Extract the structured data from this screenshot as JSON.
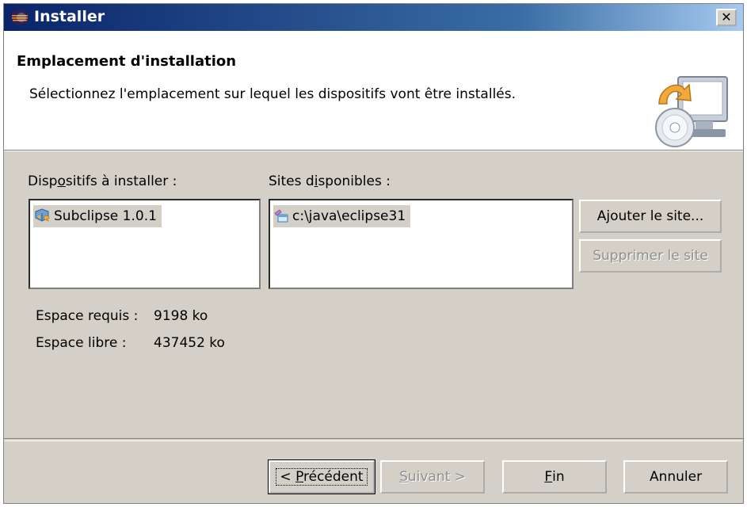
{
  "window": {
    "title": "Installer",
    "close_glyph": "✕"
  },
  "header": {
    "title": "Emplacement d'installation",
    "description": "Sélectionnez l'emplacement sur lequel les dispositifs vont être installés."
  },
  "features": {
    "label_pre": "Disp",
    "label_mn": "o",
    "label_post": "sitifs à installer :",
    "items": [
      {
        "label": "Subclipse 1.0.1",
        "icon": "feature-icon"
      }
    ]
  },
  "sites": {
    "label_pre": "Sites d",
    "label_mn": "i",
    "label_post": "sponibles :",
    "items": [
      {
        "label": "c:\\java\\eclipse31",
        "icon": "local-site-icon"
      }
    ]
  },
  "site_buttons": {
    "add_pre": "A",
    "add_mn": "j",
    "add_post": "outer le site...",
    "remove_pre": "Su",
    "remove_mn": "p",
    "remove_post": "primer le site"
  },
  "space": {
    "required_label": "Espace requis :",
    "required_value": "9198 ko",
    "free_label": "Espace libre :",
    "free_value": "437452 ko"
  },
  "footer": {
    "back_pre": "< ",
    "back_mn": "P",
    "back_post": "récédent",
    "next_mn": "S",
    "next_post": "uivant >",
    "finish_mn": "F",
    "finish_post": "in",
    "cancel": "Annuler"
  }
}
